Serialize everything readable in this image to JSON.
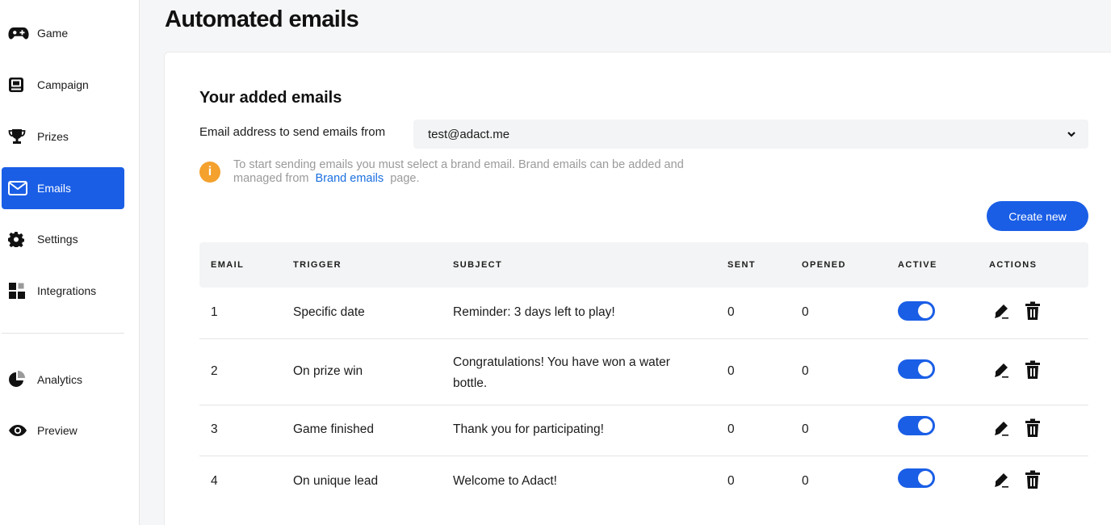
{
  "sidebar": {
    "items": [
      {
        "label": "Game",
        "icon": "gamepad-icon",
        "active": false
      },
      {
        "label": "Campaign",
        "icon": "campaign-icon",
        "active": false
      },
      {
        "label": "Prizes",
        "icon": "trophy-icon",
        "active": false
      },
      {
        "label": "Emails",
        "icon": "envelope-icon",
        "active": true
      },
      {
        "label": "Settings",
        "icon": "gear-icon",
        "active": false
      },
      {
        "label": "Integrations",
        "icon": "integrations-icon",
        "active": false
      },
      {
        "label": "Analytics",
        "icon": "pie-chart-icon",
        "active": false
      },
      {
        "label": "Preview",
        "icon": "eye-icon",
        "active": false
      }
    ]
  },
  "page": {
    "title": "Automated emails"
  },
  "section": {
    "title": "Your added emails",
    "from_label": "Email address to send emails from",
    "from_value": "test@adact.me",
    "notice_text_1": "To start sending emails you must select a brand email. Brand emails can be added and managed from",
    "notice_link": "Brand emails",
    "notice_text_2": "page.",
    "notice_icon": "i",
    "create_button": "Create new"
  },
  "table": {
    "headers": [
      "EMAIL",
      "TRIGGER",
      "SUBJECT",
      "SENT",
      "OPENED",
      "ACTIVE",
      "ACTIONS"
    ],
    "rows": [
      {
        "email": "1",
        "trigger": "Specific date",
        "subject": "Reminder: 3 days left to play!",
        "sent": "0",
        "opened": "0",
        "active": true
      },
      {
        "email": "2",
        "trigger": "On prize win",
        "subject": "Congratulations! You have won a water bottle.",
        "sent": "0",
        "opened": "0",
        "active": true
      },
      {
        "email": "3",
        "trigger": "Game finished",
        "subject": "Thank you for participating!",
        "sent": "0",
        "opened": "0",
        "active": true
      },
      {
        "email": "4",
        "trigger": "On unique lead",
        "subject": "Welcome to Adact!",
        "sent": "0",
        "opened": "0",
        "active": true
      }
    ]
  },
  "colors": {
    "accent": "#1a5ee6",
    "notice": "#f4a12d",
    "link": "#1a6fe0"
  }
}
